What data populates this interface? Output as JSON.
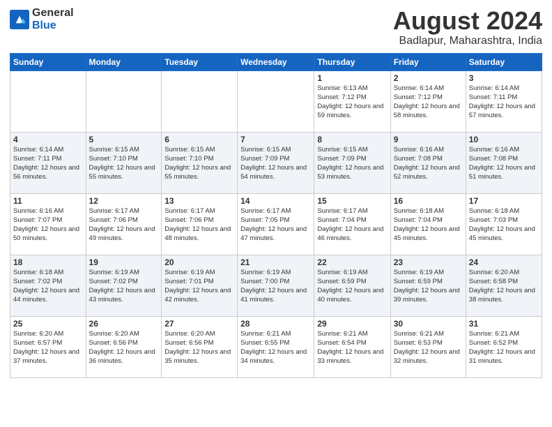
{
  "logo": {
    "general": "General",
    "blue": "Blue"
  },
  "header": {
    "month_year": "August 2024",
    "location": "Badlapur, Maharashtra, India"
  },
  "days_of_week": [
    "Sunday",
    "Monday",
    "Tuesday",
    "Wednesday",
    "Thursday",
    "Friday",
    "Saturday"
  ],
  "weeks": [
    [
      {
        "day": "",
        "sunrise": "",
        "sunset": "",
        "daylight": ""
      },
      {
        "day": "",
        "sunrise": "",
        "sunset": "",
        "daylight": ""
      },
      {
        "day": "",
        "sunrise": "",
        "sunset": "",
        "daylight": ""
      },
      {
        "day": "",
        "sunrise": "",
        "sunset": "",
        "daylight": ""
      },
      {
        "day": "1",
        "sunrise": "Sunrise: 6:13 AM",
        "sunset": "Sunset: 7:12 PM",
        "daylight": "Daylight: 12 hours and 59 minutes."
      },
      {
        "day": "2",
        "sunrise": "Sunrise: 6:14 AM",
        "sunset": "Sunset: 7:12 PM",
        "daylight": "Daylight: 12 hours and 58 minutes."
      },
      {
        "day": "3",
        "sunrise": "Sunrise: 6:14 AM",
        "sunset": "Sunset: 7:11 PM",
        "daylight": "Daylight: 12 hours and 57 minutes."
      }
    ],
    [
      {
        "day": "4",
        "sunrise": "Sunrise: 6:14 AM",
        "sunset": "Sunset: 7:11 PM",
        "daylight": "Daylight: 12 hours and 56 minutes."
      },
      {
        "day": "5",
        "sunrise": "Sunrise: 6:15 AM",
        "sunset": "Sunset: 7:10 PM",
        "daylight": "Daylight: 12 hours and 55 minutes."
      },
      {
        "day": "6",
        "sunrise": "Sunrise: 6:15 AM",
        "sunset": "Sunset: 7:10 PM",
        "daylight": "Daylight: 12 hours and 55 minutes."
      },
      {
        "day": "7",
        "sunrise": "Sunrise: 6:15 AM",
        "sunset": "Sunset: 7:09 PM",
        "daylight": "Daylight: 12 hours and 54 minutes."
      },
      {
        "day": "8",
        "sunrise": "Sunrise: 6:15 AM",
        "sunset": "Sunset: 7:09 PM",
        "daylight": "Daylight: 12 hours and 53 minutes."
      },
      {
        "day": "9",
        "sunrise": "Sunrise: 6:16 AM",
        "sunset": "Sunset: 7:08 PM",
        "daylight": "Daylight: 12 hours and 52 minutes."
      },
      {
        "day": "10",
        "sunrise": "Sunrise: 6:16 AM",
        "sunset": "Sunset: 7:08 PM",
        "daylight": "Daylight: 12 hours and 51 minutes."
      }
    ],
    [
      {
        "day": "11",
        "sunrise": "Sunrise: 6:16 AM",
        "sunset": "Sunset: 7:07 PM",
        "daylight": "Daylight: 12 hours and 50 minutes."
      },
      {
        "day": "12",
        "sunrise": "Sunrise: 6:17 AM",
        "sunset": "Sunset: 7:06 PM",
        "daylight": "Daylight: 12 hours and 49 minutes."
      },
      {
        "day": "13",
        "sunrise": "Sunrise: 6:17 AM",
        "sunset": "Sunset: 7:06 PM",
        "daylight": "Daylight: 12 hours and 48 minutes."
      },
      {
        "day": "14",
        "sunrise": "Sunrise: 6:17 AM",
        "sunset": "Sunset: 7:05 PM",
        "daylight": "Daylight: 12 hours and 47 minutes."
      },
      {
        "day": "15",
        "sunrise": "Sunrise: 6:17 AM",
        "sunset": "Sunset: 7:04 PM",
        "daylight": "Daylight: 12 hours and 46 minutes."
      },
      {
        "day": "16",
        "sunrise": "Sunrise: 6:18 AM",
        "sunset": "Sunset: 7:04 PM",
        "daylight": "Daylight: 12 hours and 45 minutes."
      },
      {
        "day": "17",
        "sunrise": "Sunrise: 6:18 AM",
        "sunset": "Sunset: 7:03 PM",
        "daylight": "Daylight: 12 hours and 45 minutes."
      }
    ],
    [
      {
        "day": "18",
        "sunrise": "Sunrise: 6:18 AM",
        "sunset": "Sunset: 7:02 PM",
        "daylight": "Daylight: 12 hours and 44 minutes."
      },
      {
        "day": "19",
        "sunrise": "Sunrise: 6:19 AM",
        "sunset": "Sunset: 7:02 PM",
        "daylight": "Daylight: 12 hours and 43 minutes."
      },
      {
        "day": "20",
        "sunrise": "Sunrise: 6:19 AM",
        "sunset": "Sunset: 7:01 PM",
        "daylight": "Daylight: 12 hours and 42 minutes."
      },
      {
        "day": "21",
        "sunrise": "Sunrise: 6:19 AM",
        "sunset": "Sunset: 7:00 PM",
        "daylight": "Daylight: 12 hours and 41 minutes."
      },
      {
        "day": "22",
        "sunrise": "Sunrise: 6:19 AM",
        "sunset": "Sunset: 6:59 PM",
        "daylight": "Daylight: 12 hours and 40 minutes."
      },
      {
        "day": "23",
        "sunrise": "Sunrise: 6:19 AM",
        "sunset": "Sunset: 6:59 PM",
        "daylight": "Daylight: 12 hours and 39 minutes."
      },
      {
        "day": "24",
        "sunrise": "Sunrise: 6:20 AM",
        "sunset": "Sunset: 6:58 PM",
        "daylight": "Daylight: 12 hours and 38 minutes."
      }
    ],
    [
      {
        "day": "25",
        "sunrise": "Sunrise: 6:20 AM",
        "sunset": "Sunset: 6:57 PM",
        "daylight": "Daylight: 12 hours and 37 minutes."
      },
      {
        "day": "26",
        "sunrise": "Sunrise: 6:20 AM",
        "sunset": "Sunset: 6:56 PM",
        "daylight": "Daylight: 12 hours and 36 minutes."
      },
      {
        "day": "27",
        "sunrise": "Sunrise: 6:20 AM",
        "sunset": "Sunset: 6:56 PM",
        "daylight": "Daylight: 12 hours and 35 minutes."
      },
      {
        "day": "28",
        "sunrise": "Sunrise: 6:21 AM",
        "sunset": "Sunset: 6:55 PM",
        "daylight": "Daylight: 12 hours and 34 minutes."
      },
      {
        "day": "29",
        "sunrise": "Sunrise: 6:21 AM",
        "sunset": "Sunset: 6:54 PM",
        "daylight": "Daylight: 12 hours and 33 minutes."
      },
      {
        "day": "30",
        "sunrise": "Sunrise: 6:21 AM",
        "sunset": "Sunset: 6:53 PM",
        "daylight": "Daylight: 12 hours and 32 minutes."
      },
      {
        "day": "31",
        "sunrise": "Sunrise: 6:21 AM",
        "sunset": "Sunset: 6:52 PM",
        "daylight": "Daylight: 12 hours and 31 minutes."
      }
    ]
  ]
}
